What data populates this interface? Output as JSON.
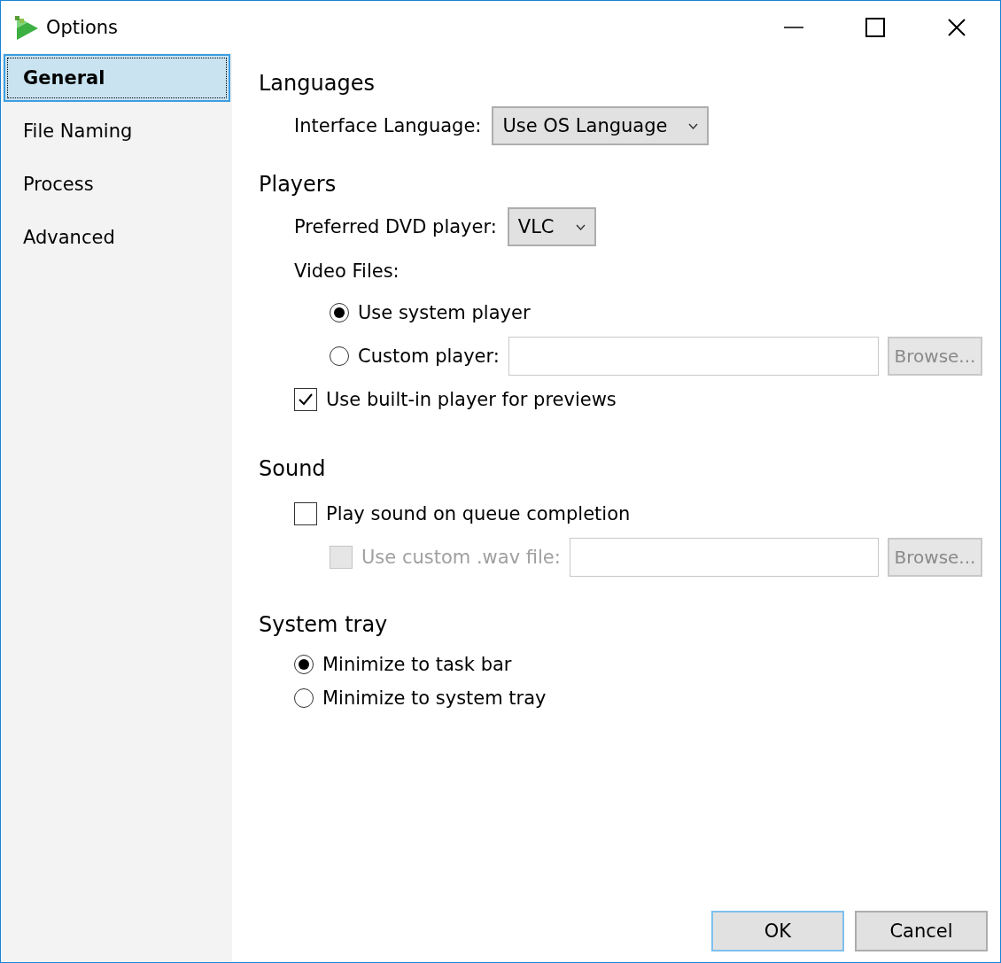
{
  "window": {
    "title": "Options"
  },
  "sidebar": {
    "items": [
      {
        "label": "General",
        "selected": true
      },
      {
        "label": "File Naming",
        "selected": false
      },
      {
        "label": "Process",
        "selected": false
      },
      {
        "label": "Advanced",
        "selected": false
      }
    ]
  },
  "languages": {
    "heading": "Languages",
    "interface_language": {
      "label": "Interface Language:",
      "value": "Use OS Language"
    }
  },
  "players": {
    "heading": "Players",
    "dvd_player": {
      "label": "Preferred DVD player:",
      "value": "VLC"
    },
    "video_files": {
      "label": "Video Files:",
      "options": [
        {
          "label": "Use system player",
          "selected": true
        },
        {
          "label": "Custom player:",
          "selected": false,
          "browse": {
            "label": "Browse...",
            "disabled": true
          }
        }
      ]
    },
    "builtin_preview": {
      "label": "Use built-in player for previews",
      "checked": true
    }
  },
  "sound": {
    "heading": "Sound",
    "play_sound": {
      "label": "Play sound on queue completion",
      "checked": false
    },
    "custom_wav": {
      "label": "Use custom .wav file:",
      "checked": false,
      "disabled": true,
      "browse": {
        "label": "Browse...",
        "disabled": true
      }
    }
  },
  "system_tray": {
    "heading": "System tray",
    "options": [
      {
        "label": "Minimize to task bar",
        "selected": true
      },
      {
        "label": "Minimize to system tray",
        "selected": false
      }
    ]
  },
  "buttons": [
    {
      "label": "OK",
      "default": true
    },
    {
      "label": "Cancel",
      "default": false
    }
  ]
}
